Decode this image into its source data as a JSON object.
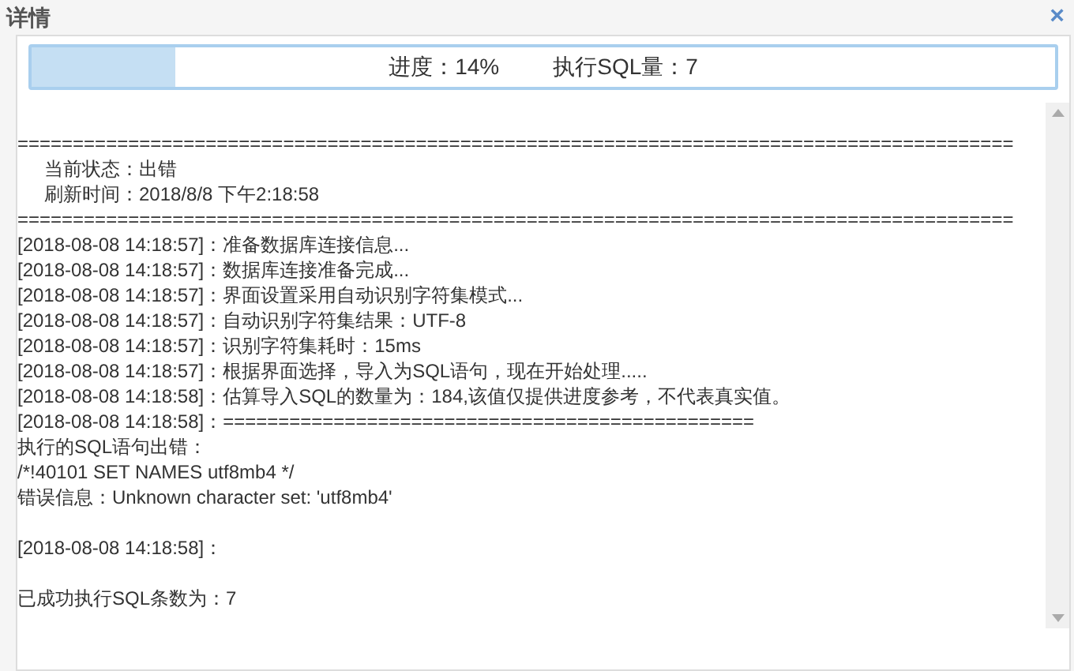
{
  "window": {
    "title": "详情",
    "close": "×"
  },
  "progress": {
    "level": 0.14,
    "label": "进度：14%",
    "count": "执行SQL量：7"
  },
  "log": [
    {
      "kind": "blank"
    },
    {
      "kind": "line",
      "text": "=========================================================================================="
    },
    {
      "kind": "indented",
      "text": "当前状态：出错"
    },
    {
      "kind": "indented",
      "text": "刷新时间：2018/8/8 下午2:18:58"
    },
    {
      "kind": "line",
      "text": "=========================================================================================="
    },
    {
      "kind": "line",
      "text": "[2018-08-08 14:18:57]：准备数据库连接信息..."
    },
    {
      "kind": "line",
      "text": "[2018-08-08 14:18:57]：数据库连接准备完成..."
    },
    {
      "kind": "line",
      "text": "[2018-08-08 14:18:57]：界面设置采用自动识别字符集模式..."
    },
    {
      "kind": "line",
      "text": "[2018-08-08 14:18:57]：自动识别字符集结果：UTF-8"
    },
    {
      "kind": "line",
      "text": "[2018-08-08 14:18:57]：识别字符集耗时：15ms"
    },
    {
      "kind": "line",
      "text": "[2018-08-08 14:18:57]：根据界面选择，导入为SQL语句，现在开始处理....."
    },
    {
      "kind": "line",
      "text": "[2018-08-08 14:18:58]：估算导入SQL的数量为：184,该值仅提供进度参考，不代表真实值。"
    },
    {
      "kind": "line",
      "text": "[2018-08-08 14:18:58]：================================================"
    },
    {
      "kind": "line",
      "text": "执行的SQL语句出错："
    },
    {
      "kind": "line",
      "text": "/*!40101 SET NAMES utf8mb4 */"
    },
    {
      "kind": "line",
      "text": "错误信息：Unknown character set: 'utf8mb4'"
    },
    {
      "kind": "blank"
    },
    {
      "kind": "line",
      "text": "[2018-08-08 14:18:58]："
    },
    {
      "kind": "blank"
    },
    {
      "kind": "line",
      "text": "已成功执行SQL条数为：7"
    }
  ]
}
